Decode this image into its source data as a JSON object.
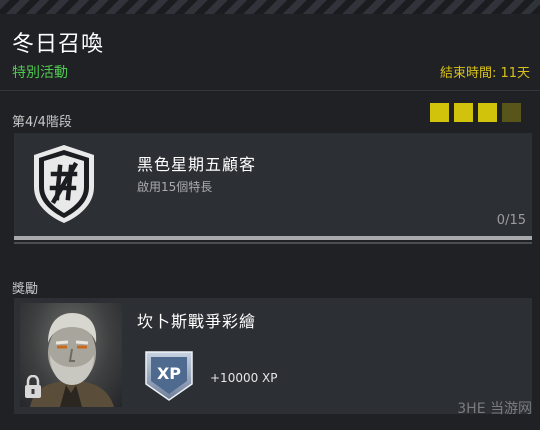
{
  "header": {
    "title": "冬日召喚",
    "subtitle": "特別活動",
    "timer": "結束時間: 11天"
  },
  "stage": {
    "label": "第4/4階段",
    "pips_total": 4,
    "pips_filled": 3
  },
  "challenge": {
    "name": "黑色星期五顧客",
    "description": "啟用15個特長",
    "progress": "0/15",
    "icon": "shield-hashtag-icon"
  },
  "reward": {
    "label": "獎勵",
    "name": "坎卜斯戰爭彩繪",
    "xp_badge_text": "XP",
    "xp_amount": "+10000 XP",
    "locked": true
  },
  "watermark": "3HE 当游网",
  "colors": {
    "accent_yellow": "#d1c20c",
    "event_green": "#4fc94f",
    "timer_yellow": "#d8c21a"
  }
}
